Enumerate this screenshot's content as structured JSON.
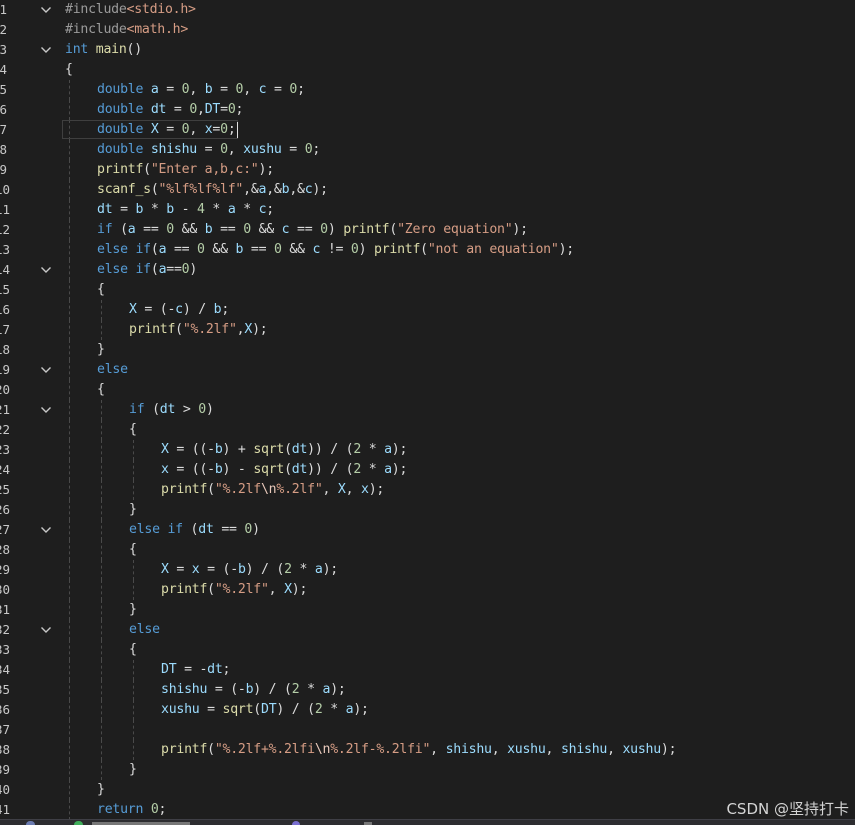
{
  "editor": {
    "lines": [
      {
        "no": "1",
        "indent": 0,
        "fold": true,
        "tokens": [
          {
            "t": "#include",
            "c": "pp"
          },
          {
            "t": "<stdio.h>",
            "c": "hdr"
          }
        ]
      },
      {
        "no": "2",
        "indent": 0,
        "tokens": [
          {
            "t": "#include",
            "c": "pp"
          },
          {
            "t": "<math.h>",
            "c": "hdr"
          }
        ]
      },
      {
        "no": "3",
        "indent": 0,
        "fold": true,
        "tokens": [
          {
            "t": "int",
            "c": "kw"
          },
          {
            "t": " "
          },
          {
            "t": "main",
            "c": "fn"
          },
          {
            "t": "()"
          }
        ]
      },
      {
        "no": "4",
        "indent": 0,
        "tokens": [
          {
            "t": "{"
          }
        ]
      },
      {
        "no": "5",
        "indent": 1,
        "tokens": [
          {
            "t": "double",
            "c": "kw"
          },
          {
            "t": " "
          },
          {
            "t": "a",
            "c": "var"
          },
          {
            "t": " = "
          },
          {
            "t": "0",
            "c": "num"
          },
          {
            "t": ", "
          },
          {
            "t": "b",
            "c": "var"
          },
          {
            "t": " = "
          },
          {
            "t": "0",
            "c": "num"
          },
          {
            "t": ", "
          },
          {
            "t": "c",
            "c": "var"
          },
          {
            "t": " = "
          },
          {
            "t": "0",
            "c": "num"
          },
          {
            "t": ";"
          }
        ]
      },
      {
        "no": "6",
        "indent": 1,
        "tokens": [
          {
            "t": "double",
            "c": "kw"
          },
          {
            "t": " "
          },
          {
            "t": "dt",
            "c": "var"
          },
          {
            "t": " = "
          },
          {
            "t": "0",
            "c": "num"
          },
          {
            "t": ","
          },
          {
            "t": "DT",
            "c": "var"
          },
          {
            "t": "="
          },
          {
            "t": "0",
            "c": "num"
          },
          {
            "t": ";"
          }
        ]
      },
      {
        "no": "7",
        "indent": 1,
        "current": true,
        "tokens": [
          {
            "t": "double",
            "c": "kw"
          },
          {
            "t": " "
          },
          {
            "t": "X",
            "c": "var"
          },
          {
            "t": " = "
          },
          {
            "t": "0",
            "c": "num"
          },
          {
            "t": ", "
          },
          {
            "t": "x",
            "c": "var"
          },
          {
            "t": "="
          },
          {
            "t": "0",
            "c": "num"
          },
          {
            "t": ";"
          }
        ]
      },
      {
        "no": "8",
        "indent": 1,
        "tokens": [
          {
            "t": "double",
            "c": "kw"
          },
          {
            "t": " "
          },
          {
            "t": "shishu",
            "c": "var"
          },
          {
            "t": " = "
          },
          {
            "t": "0",
            "c": "num"
          },
          {
            "t": ", "
          },
          {
            "t": "xushu",
            "c": "var"
          },
          {
            "t": " = "
          },
          {
            "t": "0",
            "c": "num"
          },
          {
            "t": ";"
          }
        ]
      },
      {
        "no": "9",
        "indent": 1,
        "tokens": [
          {
            "t": "printf",
            "c": "fn"
          },
          {
            "t": "("
          },
          {
            "t": "\"Enter a,b,c:\"",
            "c": "str"
          },
          {
            "t": ");"
          }
        ]
      },
      {
        "no": "10",
        "indent": 1,
        "tokens": [
          {
            "t": "scanf_s",
            "c": "fn"
          },
          {
            "t": "("
          },
          {
            "t": "\"%lf%lf%lf\"",
            "c": "str"
          },
          {
            "t": ",&"
          },
          {
            "t": "a",
            "c": "var"
          },
          {
            "t": ",&"
          },
          {
            "t": "b",
            "c": "var"
          },
          {
            "t": ",&"
          },
          {
            "t": "c",
            "c": "var"
          },
          {
            "t": ");"
          }
        ]
      },
      {
        "no": "11",
        "indent": 1,
        "tokens": [
          {
            "t": "dt",
            "c": "var"
          },
          {
            "t": " = "
          },
          {
            "t": "b",
            "c": "var"
          },
          {
            "t": " * "
          },
          {
            "t": "b",
            "c": "var"
          },
          {
            "t": " - "
          },
          {
            "t": "4",
            "c": "num"
          },
          {
            "t": " * "
          },
          {
            "t": "a",
            "c": "var"
          },
          {
            "t": " * "
          },
          {
            "t": "c",
            "c": "var"
          },
          {
            "t": ";"
          }
        ]
      },
      {
        "no": "12",
        "indent": 1,
        "tokens": [
          {
            "t": "if",
            "c": "kw"
          },
          {
            "t": " ("
          },
          {
            "t": "a",
            "c": "var"
          },
          {
            "t": " == "
          },
          {
            "t": "0",
            "c": "num"
          },
          {
            "t": " && "
          },
          {
            "t": "b",
            "c": "var"
          },
          {
            "t": " == "
          },
          {
            "t": "0",
            "c": "num"
          },
          {
            "t": " && "
          },
          {
            "t": "c",
            "c": "var"
          },
          {
            "t": " == "
          },
          {
            "t": "0",
            "c": "num"
          },
          {
            "t": ") "
          },
          {
            "t": "printf",
            "c": "fn"
          },
          {
            "t": "("
          },
          {
            "t": "\"Zero equation\"",
            "c": "str"
          },
          {
            "t": ");"
          }
        ]
      },
      {
        "no": "13",
        "indent": 1,
        "tokens": [
          {
            "t": "else",
            "c": "kw"
          },
          {
            "t": " "
          },
          {
            "t": "if",
            "c": "kw"
          },
          {
            "t": "("
          },
          {
            "t": "a",
            "c": "var"
          },
          {
            "t": " == "
          },
          {
            "t": "0",
            "c": "num"
          },
          {
            "t": " && "
          },
          {
            "t": "b",
            "c": "var"
          },
          {
            "t": " == "
          },
          {
            "t": "0",
            "c": "num"
          },
          {
            "t": " && "
          },
          {
            "t": "c",
            "c": "var"
          },
          {
            "t": " != "
          },
          {
            "t": "0",
            "c": "num"
          },
          {
            "t": ") "
          },
          {
            "t": "printf",
            "c": "fn"
          },
          {
            "t": "("
          },
          {
            "t": "\"not an equation\"",
            "c": "str"
          },
          {
            "t": ");"
          }
        ]
      },
      {
        "no": "14",
        "indent": 1,
        "fold": true,
        "tokens": [
          {
            "t": "else",
            "c": "kw"
          },
          {
            "t": " "
          },
          {
            "t": "if",
            "c": "kw"
          },
          {
            "t": "("
          },
          {
            "t": "a",
            "c": "var"
          },
          {
            "t": "=="
          },
          {
            "t": "0",
            "c": "num"
          },
          {
            "t": ")"
          }
        ]
      },
      {
        "no": "15",
        "indent": 1,
        "tokens": [
          {
            "t": "{"
          }
        ]
      },
      {
        "no": "16",
        "indent": 2,
        "tokens": [
          {
            "t": "X",
            "c": "var"
          },
          {
            "t": " = (-"
          },
          {
            "t": "c",
            "c": "var"
          },
          {
            "t": ") / "
          },
          {
            "t": "b",
            "c": "var"
          },
          {
            "t": ";"
          }
        ]
      },
      {
        "no": "17",
        "indent": 2,
        "tokens": [
          {
            "t": "printf",
            "c": "fn"
          },
          {
            "t": "("
          },
          {
            "t": "\"%.2lf\"",
            "c": "str"
          },
          {
            "t": ","
          },
          {
            "t": "X",
            "c": "var"
          },
          {
            "t": ");"
          }
        ]
      },
      {
        "no": "18",
        "indent": 1,
        "tokens": [
          {
            "t": "}"
          }
        ]
      },
      {
        "no": "19",
        "indent": 1,
        "fold": true,
        "tokens": [
          {
            "t": "else",
            "c": "kw"
          }
        ]
      },
      {
        "no": "20",
        "indent": 1,
        "tokens": [
          {
            "t": "{"
          }
        ]
      },
      {
        "no": "21",
        "indent": 2,
        "fold": true,
        "tokens": [
          {
            "t": "if",
            "c": "kw"
          },
          {
            "t": " ("
          },
          {
            "t": "dt",
            "c": "var"
          },
          {
            "t": " > "
          },
          {
            "t": "0",
            "c": "num"
          },
          {
            "t": ")"
          }
        ]
      },
      {
        "no": "22",
        "indent": 2,
        "tokens": [
          {
            "t": "{"
          }
        ]
      },
      {
        "no": "23",
        "indent": 3,
        "tokens": [
          {
            "t": "X",
            "c": "var"
          },
          {
            "t": " = ((-"
          },
          {
            "t": "b",
            "c": "var"
          },
          {
            "t": ") + "
          },
          {
            "t": "sqrt",
            "c": "fn"
          },
          {
            "t": "("
          },
          {
            "t": "dt",
            "c": "var"
          },
          {
            "t": ")) / ("
          },
          {
            "t": "2",
            "c": "num"
          },
          {
            "t": " * "
          },
          {
            "t": "a",
            "c": "var"
          },
          {
            "t": ");"
          }
        ]
      },
      {
        "no": "24",
        "indent": 3,
        "tokens": [
          {
            "t": "x",
            "c": "var"
          },
          {
            "t": " = ((-"
          },
          {
            "t": "b",
            "c": "var"
          },
          {
            "t": ") - "
          },
          {
            "t": "sqrt",
            "c": "fn"
          },
          {
            "t": "("
          },
          {
            "t": "dt",
            "c": "var"
          },
          {
            "t": ")) / ("
          },
          {
            "t": "2",
            "c": "num"
          },
          {
            "t": " * "
          },
          {
            "t": "a",
            "c": "var"
          },
          {
            "t": ");"
          }
        ]
      },
      {
        "no": "25",
        "indent": 3,
        "tokens": [
          {
            "t": "printf",
            "c": "fn"
          },
          {
            "t": "("
          },
          {
            "t": "\"%.2lf",
            "c": "str"
          },
          {
            "t": "\\n",
            "c": "esc"
          },
          {
            "t": "%.2lf\"",
            "c": "str"
          },
          {
            "t": ", "
          },
          {
            "t": "X",
            "c": "var"
          },
          {
            "t": ", "
          },
          {
            "t": "x",
            "c": "var"
          },
          {
            "t": ");"
          }
        ]
      },
      {
        "no": "26",
        "indent": 2,
        "tokens": [
          {
            "t": "}"
          }
        ]
      },
      {
        "no": "27",
        "indent": 2,
        "fold": true,
        "tokens": [
          {
            "t": "else",
            "c": "kw"
          },
          {
            "t": " "
          },
          {
            "t": "if",
            "c": "kw"
          },
          {
            "t": " ("
          },
          {
            "t": "dt",
            "c": "var"
          },
          {
            "t": " == "
          },
          {
            "t": "0",
            "c": "num"
          },
          {
            "t": ")"
          }
        ]
      },
      {
        "no": "28",
        "indent": 2,
        "tokens": [
          {
            "t": "{"
          }
        ]
      },
      {
        "no": "29",
        "indent": 3,
        "tokens": [
          {
            "t": "X",
            "c": "var"
          },
          {
            "t": " = "
          },
          {
            "t": "x",
            "c": "var"
          },
          {
            "t": " = (-"
          },
          {
            "t": "b",
            "c": "var"
          },
          {
            "t": ") / ("
          },
          {
            "t": "2",
            "c": "num"
          },
          {
            "t": " * "
          },
          {
            "t": "a",
            "c": "var"
          },
          {
            "t": ");"
          }
        ]
      },
      {
        "no": "30",
        "indent": 3,
        "tokens": [
          {
            "t": "printf",
            "c": "fn"
          },
          {
            "t": "("
          },
          {
            "t": "\"%.2lf\"",
            "c": "str"
          },
          {
            "t": ", "
          },
          {
            "t": "X",
            "c": "var"
          },
          {
            "t": ");"
          }
        ]
      },
      {
        "no": "31",
        "indent": 2,
        "tokens": [
          {
            "t": "}"
          }
        ]
      },
      {
        "no": "32",
        "indent": 2,
        "fold": true,
        "tokens": [
          {
            "t": "else",
            "c": "kw"
          }
        ]
      },
      {
        "no": "33",
        "indent": 2,
        "tokens": [
          {
            "t": "{"
          }
        ]
      },
      {
        "no": "34",
        "indent": 3,
        "tokens": [
          {
            "t": "DT",
            "c": "var"
          },
          {
            "t": " = -"
          },
          {
            "t": "dt",
            "c": "var"
          },
          {
            "t": ";"
          }
        ]
      },
      {
        "no": "35",
        "indent": 3,
        "tokens": [
          {
            "t": "shishu",
            "c": "var"
          },
          {
            "t": " = (-"
          },
          {
            "t": "b",
            "c": "var"
          },
          {
            "t": ") / ("
          },
          {
            "t": "2",
            "c": "num"
          },
          {
            "t": " * "
          },
          {
            "t": "a",
            "c": "var"
          },
          {
            "t": ");"
          }
        ]
      },
      {
        "no": "36",
        "indent": 3,
        "tokens": [
          {
            "t": "xushu",
            "c": "var"
          },
          {
            "t": " = "
          },
          {
            "t": "sqrt",
            "c": "fn"
          },
          {
            "t": "("
          },
          {
            "t": "DT",
            "c": "var"
          },
          {
            "t": ") / ("
          },
          {
            "t": "2",
            "c": "num"
          },
          {
            "t": " * "
          },
          {
            "t": "a",
            "c": "var"
          },
          {
            "t": ");"
          }
        ]
      },
      {
        "no": "37",
        "indent": 3,
        "tokens": []
      },
      {
        "no": "38",
        "indent": 3,
        "tokens": [
          {
            "t": "printf",
            "c": "fn"
          },
          {
            "t": "("
          },
          {
            "t": "\"%.2lf+%.2lfi",
            "c": "str"
          },
          {
            "t": "\\n",
            "c": "esc"
          },
          {
            "t": "%.2lf-%.2lfi\"",
            "c": "str"
          },
          {
            "t": ", "
          },
          {
            "t": "shishu",
            "c": "var"
          },
          {
            "t": ", "
          },
          {
            "t": "xushu",
            "c": "var"
          },
          {
            "t": ", "
          },
          {
            "t": "shishu",
            "c": "var"
          },
          {
            "t": ", "
          },
          {
            "t": "xushu",
            "c": "var"
          },
          {
            "t": ");"
          }
        ]
      },
      {
        "no": "39",
        "indent": 2,
        "tokens": [
          {
            "t": "}"
          }
        ]
      },
      {
        "no": "40",
        "indent": 1,
        "tokens": [
          {
            "t": "}"
          }
        ]
      },
      {
        "no": "41",
        "indent": 1,
        "tokens": [
          {
            "t": "return",
            "c": "kw"
          },
          {
            "t": " "
          },
          {
            "t": "0",
            "c": "num"
          },
          {
            "t": ";"
          }
        ]
      }
    ]
  },
  "watermark": "CSDN @坚持打卡",
  "colors": {
    "background": "#1e1e1e",
    "keyword": "#569cd6",
    "string": "#d69d85",
    "function": "#dcdcaa",
    "variable": "#9cdcfe",
    "number": "#b5cea8",
    "preprocessor": "#9b9b9b"
  },
  "icons": [
    "fold-collapse-icon",
    "status-indicator-icon"
  ]
}
